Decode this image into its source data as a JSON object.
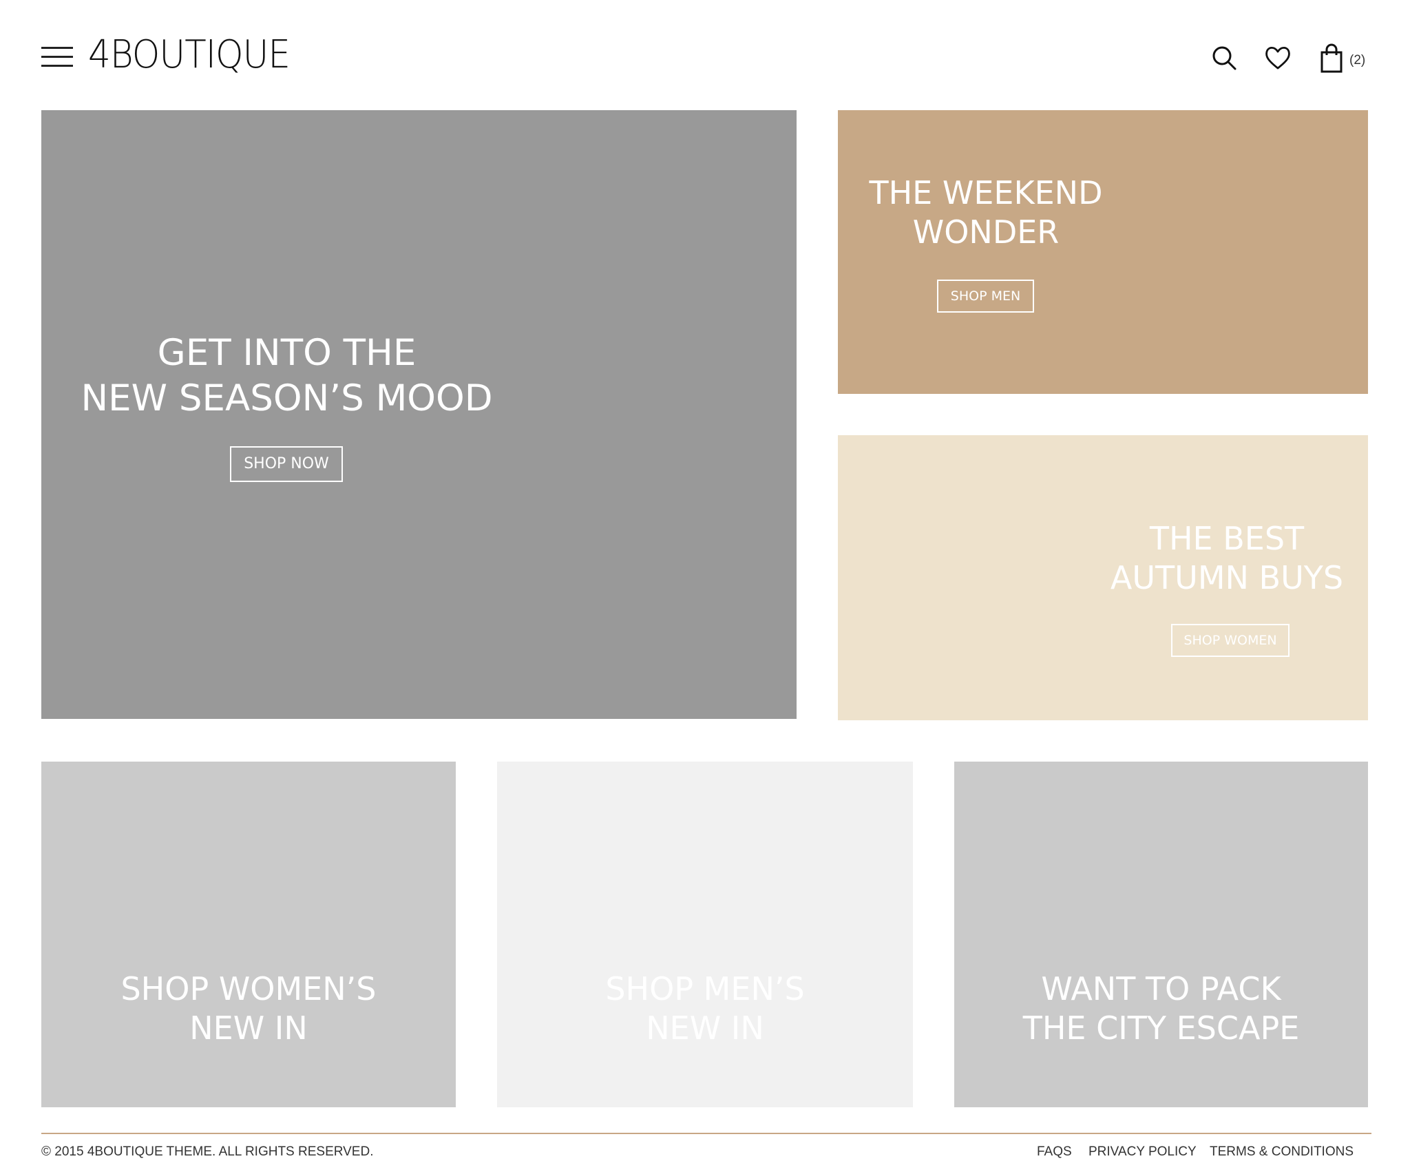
{
  "header": {
    "logo_text": "4BOUTIQUE",
    "cart_count": "(2)",
    "icons": [
      "menu-icon",
      "search-icon",
      "heart-icon",
      "shopping-bag-icon"
    ]
  },
  "hero": {
    "title_line1": "GET INTO THE",
    "title_line2": "NEW SEASON’S MOOD",
    "button": "SHOP NOW",
    "bg_color": "#999999"
  },
  "weekend": {
    "title_line1": "THE WEEKEND",
    "title_line2": "WONDER",
    "button": "SHOP MEN",
    "bg_color": "#c7a886"
  },
  "autumn": {
    "title_line1": "THE BEST",
    "title_line2": "AUTUMN BUYS",
    "button": "SHOP WOMEN",
    "bg_color": "#eee2cc"
  },
  "bottom_tiles": [
    {
      "line1": "SHOP WOMEN’S",
      "line2": "NEW IN",
      "bg_color": "#cacaca"
    },
    {
      "line1": "SHOP MEN’S",
      "line2": "NEW IN",
      "bg_color": "#f1f1f1"
    },
    {
      "line1": "WANT TO PACK",
      "line2": "THE CITY ESCAPE",
      "bg_color": "#cacaca"
    }
  ],
  "footer": {
    "copyright": "© 2015 4BOUTIQUE THEME. ALL RIGHTS RESERVED.",
    "links": [
      "FAQS",
      "PRIVACY POLICY",
      "TERMS & CONDITIONS"
    ],
    "accent_color": "#c8a785"
  }
}
